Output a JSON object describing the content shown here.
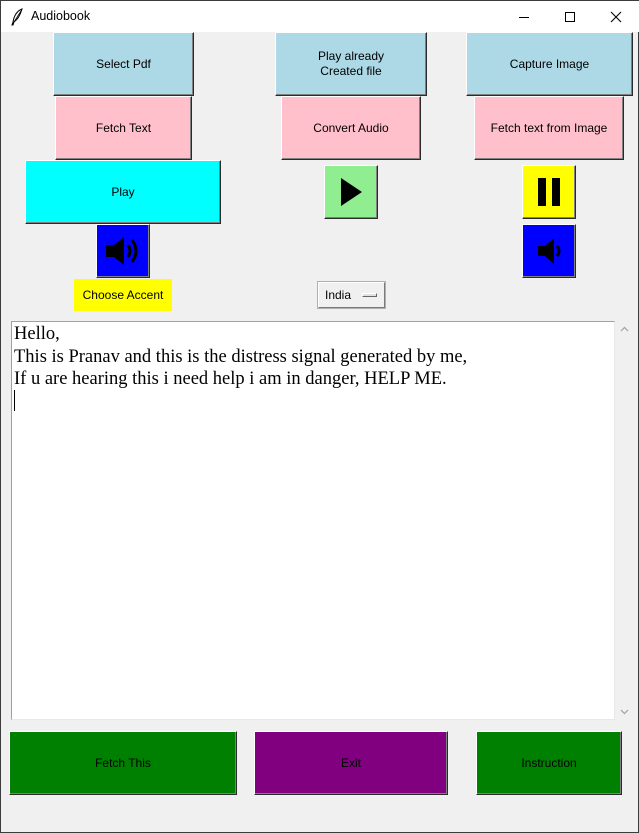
{
  "window": {
    "title": "Audiobook",
    "app_icon": "feather-icon",
    "controls": {
      "minimize": "minimize-icon",
      "maximize": "maximize-icon",
      "close": "close-icon"
    }
  },
  "buttons": {
    "select_pdf": "Select Pdf",
    "play_created": "Play already\nCreated file",
    "capture_image": "Capture Image",
    "fetch_text": "Fetch Text",
    "convert_audio": "Convert Audio",
    "fetch_text_image": "Fetch text from Image",
    "play": "Play",
    "fetch_this": "Fetch This",
    "exit": "Exit",
    "instruction": "Instruction"
  },
  "icons": {
    "play": "play-icon",
    "pause": "pause-icon",
    "speaker_loud": "speaker-loud-icon",
    "speaker_soft": "speaker-soft-icon"
  },
  "accent": {
    "label": "Choose Accent",
    "selected": "India"
  },
  "textarea": {
    "content": "Hello,\nThis is Pranav and this is the distress signal generated by me,\nIf u are hearing this i need help i am in danger, HELP ME."
  },
  "colors": {
    "lightblue": "#add8e6",
    "pink": "#ffc0cb",
    "cyan": "#00ffff",
    "lightgreen": "#90ee90",
    "yellow": "#ffff00",
    "blue": "#0000ff",
    "green": "#008000",
    "purple": "#800080"
  }
}
